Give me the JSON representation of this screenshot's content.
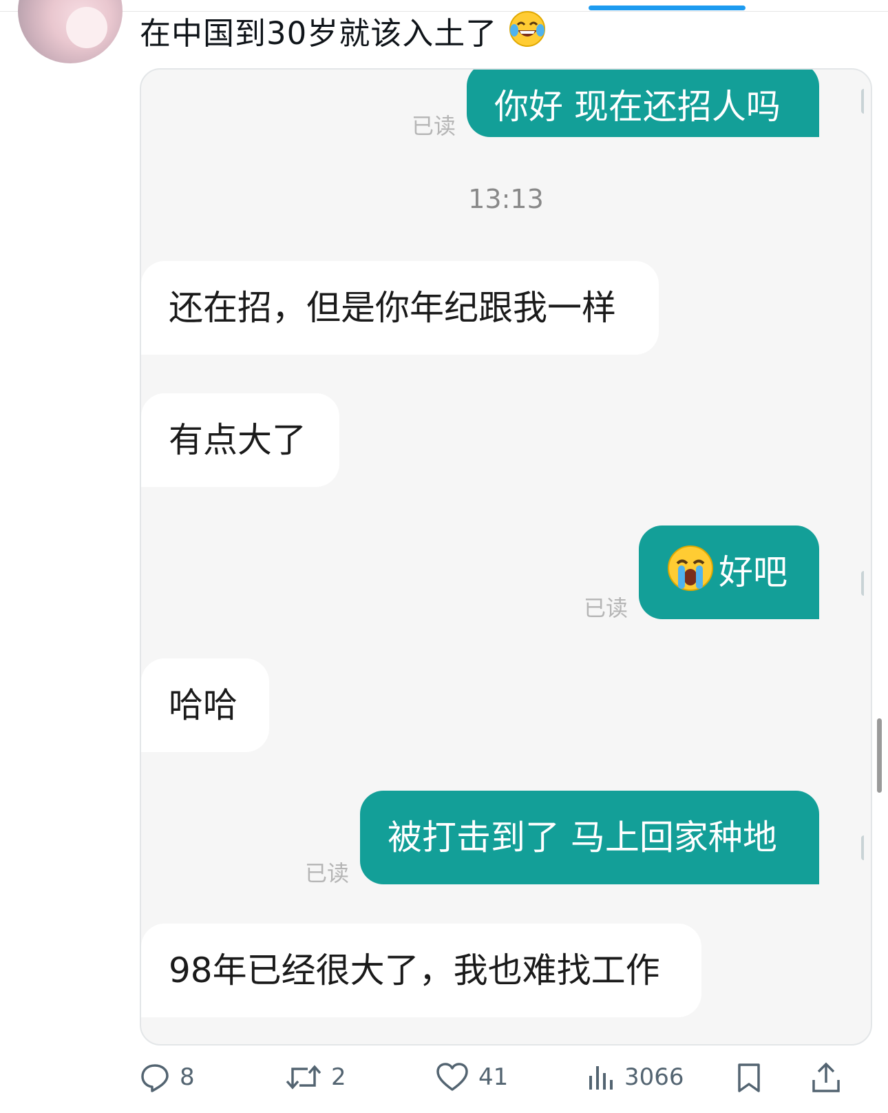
{
  "tweet": {
    "text": "在中国到30岁就该入土了",
    "emoji": "face-with-tears-of-joy"
  },
  "chat": {
    "messages": [
      {
        "side": "sent",
        "text": "你好 现在还招人吗",
        "status": "已读"
      },
      {
        "type": "timestamp",
        "text": "13:13"
      },
      {
        "side": "received",
        "text": "还在招，但是你年纪跟我一样"
      },
      {
        "side": "received",
        "text": "有点大了"
      },
      {
        "side": "sent",
        "text": "好吧",
        "emoji": "loudly-crying-face",
        "status": "已读"
      },
      {
        "side": "received",
        "text": "哈哈"
      },
      {
        "side": "sent",
        "text": "被打击到了 马上回家种地",
        "status": "已读"
      },
      {
        "side": "received",
        "text": "98年已经很大了，我也难找工作"
      }
    ]
  },
  "actions": {
    "replies": "8",
    "retweets": "2",
    "likes": "41",
    "views": "3066"
  },
  "colors": {
    "sent_bubble": "#139f98",
    "received_bubble": "#ffffff",
    "chat_background": "#f6f6f6",
    "accent": "#1d9bf0",
    "icon_gray": "#536471"
  }
}
